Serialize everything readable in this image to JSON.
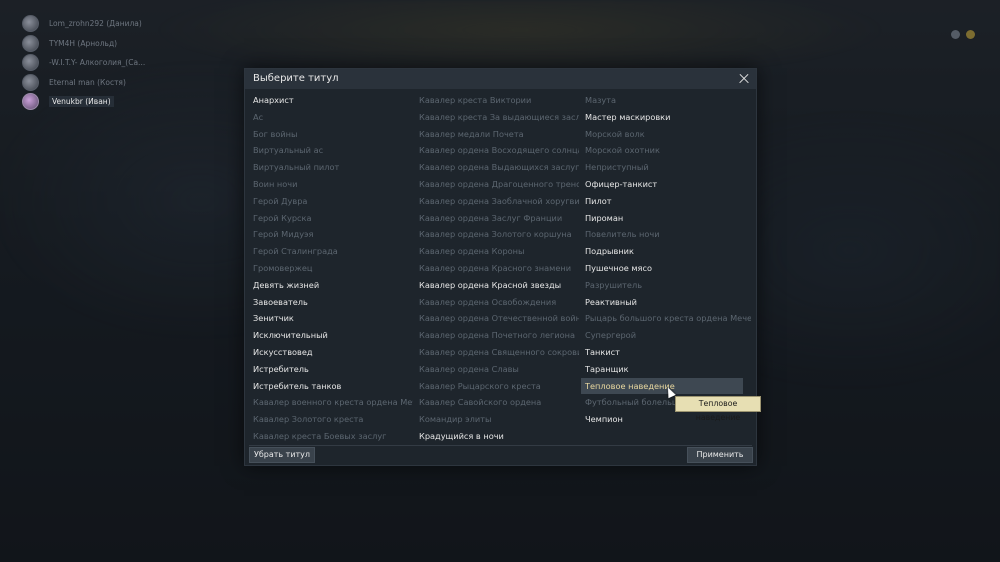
{
  "modal": {
    "title": "Выберите титул",
    "remove_label": "Убрать титул",
    "apply_label": "Применить",
    "tooltip": "Тепловое наведение"
  },
  "squad": [
    {
      "name": "Lom_zrohn292 (Данила)",
      "active": false
    },
    {
      "name": "TYM4H (Арнольд)",
      "active": false
    },
    {
      "name": "-W.I.T.Y- Алкоголия_(Са...",
      "active": false
    },
    {
      "name": "Eternal man (Костя)",
      "active": false
    },
    {
      "name": "Venukbr (Иван)",
      "active": true
    }
  ],
  "columns": [
    [
      {
        "label": "Анархист",
        "on": true
      },
      {
        "label": "Ас",
        "on": false
      },
      {
        "label": "Бог войны",
        "on": false
      },
      {
        "label": "Виртуальный ас",
        "on": false
      },
      {
        "label": "Виртуальный пилот",
        "on": false
      },
      {
        "label": "Воин ночи",
        "on": false
      },
      {
        "label": "Герой Дувра",
        "on": false
      },
      {
        "label": "Герой Курска",
        "on": false
      },
      {
        "label": "Герой Мидуэя",
        "on": false
      },
      {
        "label": "Герой Сталинграда",
        "on": false
      },
      {
        "label": "Громовержец",
        "on": false
      },
      {
        "label": "Девять жизней",
        "on": true
      },
      {
        "label": "Завоеватель",
        "on": true
      },
      {
        "label": "Зенитчик",
        "on": true
      },
      {
        "label": "Исключительный",
        "on": true
      },
      {
        "label": "Искусствовед",
        "on": true
      },
      {
        "label": "Истребитель",
        "on": true
      },
      {
        "label": "Истребитель танков",
        "on": true
      },
      {
        "label": "Кавалер военного креста ордена Мечей",
        "on": false
      },
      {
        "label": "Кавалер Золотого креста",
        "on": false
      },
      {
        "label": "Кавалер креста Боевых заслуг",
        "on": false
      }
    ],
    [
      {
        "label": "Кавалер креста Виктории",
        "on": false
      },
      {
        "label": "Кавалер креста За выдающиеся заслуги",
        "on": false
      },
      {
        "label": "Кавалер медали Почета",
        "on": false
      },
      {
        "label": "Кавалер ордена Восходящего солнца",
        "on": false
      },
      {
        "label": "Кавалер ордена Выдающихся заслуг",
        "on": false
      },
      {
        "label": "Кавалер ордена Драгоценного треножника",
        "on": false
      },
      {
        "label": "Кавалер ордена Заоблачной хоругви",
        "on": false
      },
      {
        "label": "Кавалер ордена Заслуг Франции",
        "on": false
      },
      {
        "label": "Кавалер ордена Золотого коршуна",
        "on": false
      },
      {
        "label": "Кавалер ордена Короны",
        "on": false
      },
      {
        "label": "Кавалер ордена Красного знамени",
        "on": false
      },
      {
        "label": "Кавалер ордена Красной звезды",
        "on": true
      },
      {
        "label": "Кавалер ордена Освобождения",
        "on": false
      },
      {
        "label": "Кавалер ордена Отечественной войны",
        "on": false
      },
      {
        "label": "Кавалер ордена Почетного легиона",
        "on": false
      },
      {
        "label": "Кавалер ордена Священного сокровища",
        "on": false
      },
      {
        "label": "Кавалер ордена Славы",
        "on": false
      },
      {
        "label": "Кавалер Рыцарского креста",
        "on": false
      },
      {
        "label": "Кавалер Савойского ордена",
        "on": false
      },
      {
        "label": "Командир элиты",
        "on": false
      },
      {
        "label": "Крадущийся в ночи",
        "on": true
      }
    ],
    [
      {
        "label": "Мазута",
        "on": false
      },
      {
        "label": "Мастер маскировки",
        "on": true
      },
      {
        "label": "Морской волк",
        "on": false
      },
      {
        "label": "Морской охотник",
        "on": false
      },
      {
        "label": "Неприступный",
        "on": false
      },
      {
        "label": "Офицер-танкист",
        "on": true
      },
      {
        "label": "Пилот",
        "on": true
      },
      {
        "label": "Пироман",
        "on": true
      },
      {
        "label": "Повелитель ночи",
        "on": false
      },
      {
        "label": "Подрывник",
        "on": true
      },
      {
        "label": "Пушечное мясо",
        "on": true
      },
      {
        "label": "Разрушитель",
        "on": false
      },
      {
        "label": "Реактивный",
        "on": true
      },
      {
        "label": "Рыцарь большого креста ордена Мечей",
        "on": false
      },
      {
        "label": "Супергерой",
        "on": false
      },
      {
        "label": "Танкист",
        "on": true
      },
      {
        "label": "Таранщик",
        "on": true
      },
      {
        "label": "Тепловое наведение",
        "on": true,
        "hover": true
      },
      {
        "label": "Футбольный болельщик",
        "on": false
      },
      {
        "label": "Чемпион",
        "on": true
      }
    ]
  ]
}
